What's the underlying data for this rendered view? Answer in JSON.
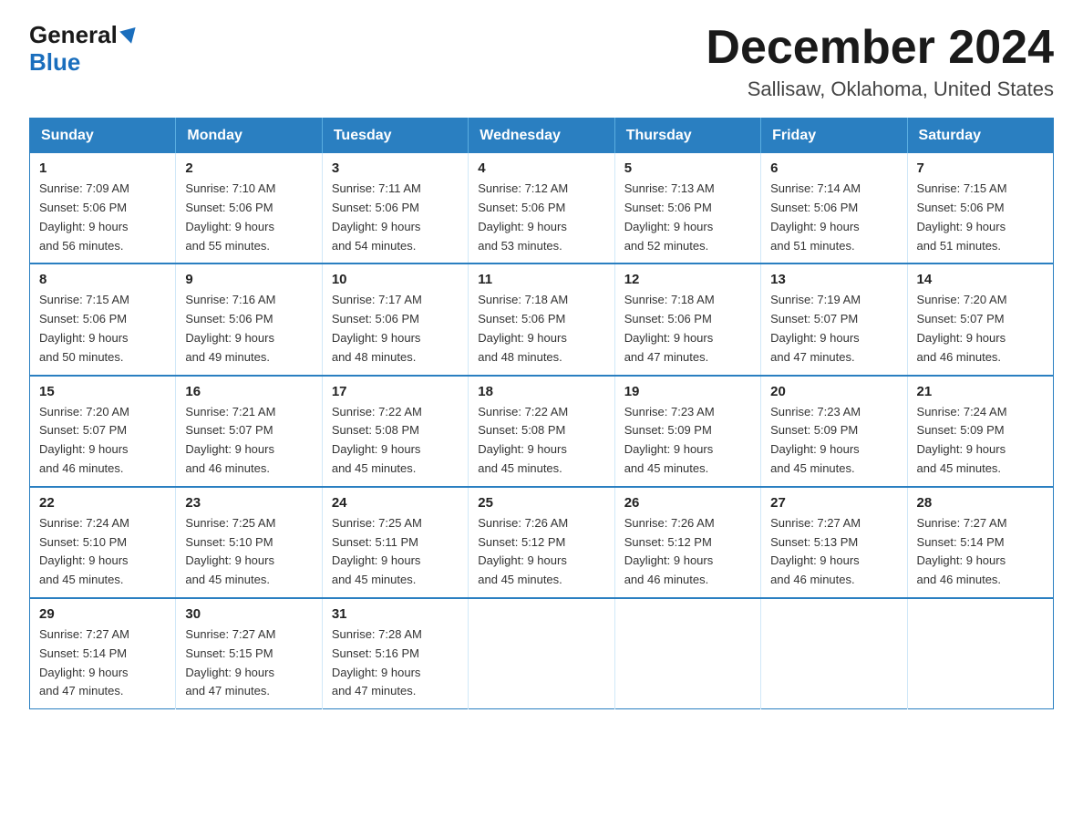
{
  "logo": {
    "general": "General",
    "blue": "Blue"
  },
  "title": "December 2024",
  "location": "Sallisaw, Oklahoma, United States",
  "weekdays": [
    "Sunday",
    "Monday",
    "Tuesday",
    "Wednesday",
    "Thursday",
    "Friday",
    "Saturday"
  ],
  "weeks": [
    [
      {
        "day": "1",
        "sunrise": "7:09 AM",
        "sunset": "5:06 PM",
        "daylight": "9 hours and 56 minutes."
      },
      {
        "day": "2",
        "sunrise": "7:10 AM",
        "sunset": "5:06 PM",
        "daylight": "9 hours and 55 minutes."
      },
      {
        "day": "3",
        "sunrise": "7:11 AM",
        "sunset": "5:06 PM",
        "daylight": "9 hours and 54 minutes."
      },
      {
        "day": "4",
        "sunrise": "7:12 AM",
        "sunset": "5:06 PM",
        "daylight": "9 hours and 53 minutes."
      },
      {
        "day": "5",
        "sunrise": "7:13 AM",
        "sunset": "5:06 PM",
        "daylight": "9 hours and 52 minutes."
      },
      {
        "day": "6",
        "sunrise": "7:14 AM",
        "sunset": "5:06 PM",
        "daylight": "9 hours and 51 minutes."
      },
      {
        "day": "7",
        "sunrise": "7:15 AM",
        "sunset": "5:06 PM",
        "daylight": "9 hours and 51 minutes."
      }
    ],
    [
      {
        "day": "8",
        "sunrise": "7:15 AM",
        "sunset": "5:06 PM",
        "daylight": "9 hours and 50 minutes."
      },
      {
        "day": "9",
        "sunrise": "7:16 AM",
        "sunset": "5:06 PM",
        "daylight": "9 hours and 49 minutes."
      },
      {
        "day": "10",
        "sunrise": "7:17 AM",
        "sunset": "5:06 PM",
        "daylight": "9 hours and 48 minutes."
      },
      {
        "day": "11",
        "sunrise": "7:18 AM",
        "sunset": "5:06 PM",
        "daylight": "9 hours and 48 minutes."
      },
      {
        "day": "12",
        "sunrise": "7:18 AM",
        "sunset": "5:06 PM",
        "daylight": "9 hours and 47 minutes."
      },
      {
        "day": "13",
        "sunrise": "7:19 AM",
        "sunset": "5:07 PM",
        "daylight": "9 hours and 47 minutes."
      },
      {
        "day": "14",
        "sunrise": "7:20 AM",
        "sunset": "5:07 PM",
        "daylight": "9 hours and 46 minutes."
      }
    ],
    [
      {
        "day": "15",
        "sunrise": "7:20 AM",
        "sunset": "5:07 PM",
        "daylight": "9 hours and 46 minutes."
      },
      {
        "day": "16",
        "sunrise": "7:21 AM",
        "sunset": "5:07 PM",
        "daylight": "9 hours and 46 minutes."
      },
      {
        "day": "17",
        "sunrise": "7:22 AM",
        "sunset": "5:08 PM",
        "daylight": "9 hours and 45 minutes."
      },
      {
        "day": "18",
        "sunrise": "7:22 AM",
        "sunset": "5:08 PM",
        "daylight": "9 hours and 45 minutes."
      },
      {
        "day": "19",
        "sunrise": "7:23 AM",
        "sunset": "5:09 PM",
        "daylight": "9 hours and 45 minutes."
      },
      {
        "day": "20",
        "sunrise": "7:23 AM",
        "sunset": "5:09 PM",
        "daylight": "9 hours and 45 minutes."
      },
      {
        "day": "21",
        "sunrise": "7:24 AM",
        "sunset": "5:09 PM",
        "daylight": "9 hours and 45 minutes."
      }
    ],
    [
      {
        "day": "22",
        "sunrise": "7:24 AM",
        "sunset": "5:10 PM",
        "daylight": "9 hours and 45 minutes."
      },
      {
        "day": "23",
        "sunrise": "7:25 AM",
        "sunset": "5:10 PM",
        "daylight": "9 hours and 45 minutes."
      },
      {
        "day": "24",
        "sunrise": "7:25 AM",
        "sunset": "5:11 PM",
        "daylight": "9 hours and 45 minutes."
      },
      {
        "day": "25",
        "sunrise": "7:26 AM",
        "sunset": "5:12 PM",
        "daylight": "9 hours and 45 minutes."
      },
      {
        "day": "26",
        "sunrise": "7:26 AM",
        "sunset": "5:12 PM",
        "daylight": "9 hours and 46 minutes."
      },
      {
        "day": "27",
        "sunrise": "7:27 AM",
        "sunset": "5:13 PM",
        "daylight": "9 hours and 46 minutes."
      },
      {
        "day": "28",
        "sunrise": "7:27 AM",
        "sunset": "5:14 PM",
        "daylight": "9 hours and 46 minutes."
      }
    ],
    [
      {
        "day": "29",
        "sunrise": "7:27 AM",
        "sunset": "5:14 PM",
        "daylight": "9 hours and 47 minutes."
      },
      {
        "day": "30",
        "sunrise": "7:27 AM",
        "sunset": "5:15 PM",
        "daylight": "9 hours and 47 minutes."
      },
      {
        "day": "31",
        "sunrise": "7:28 AM",
        "sunset": "5:16 PM",
        "daylight": "9 hours and 47 minutes."
      },
      null,
      null,
      null,
      null
    ]
  ],
  "labels": {
    "sunrise": "Sunrise:",
    "sunset": "Sunset:",
    "daylight": "Daylight:"
  }
}
